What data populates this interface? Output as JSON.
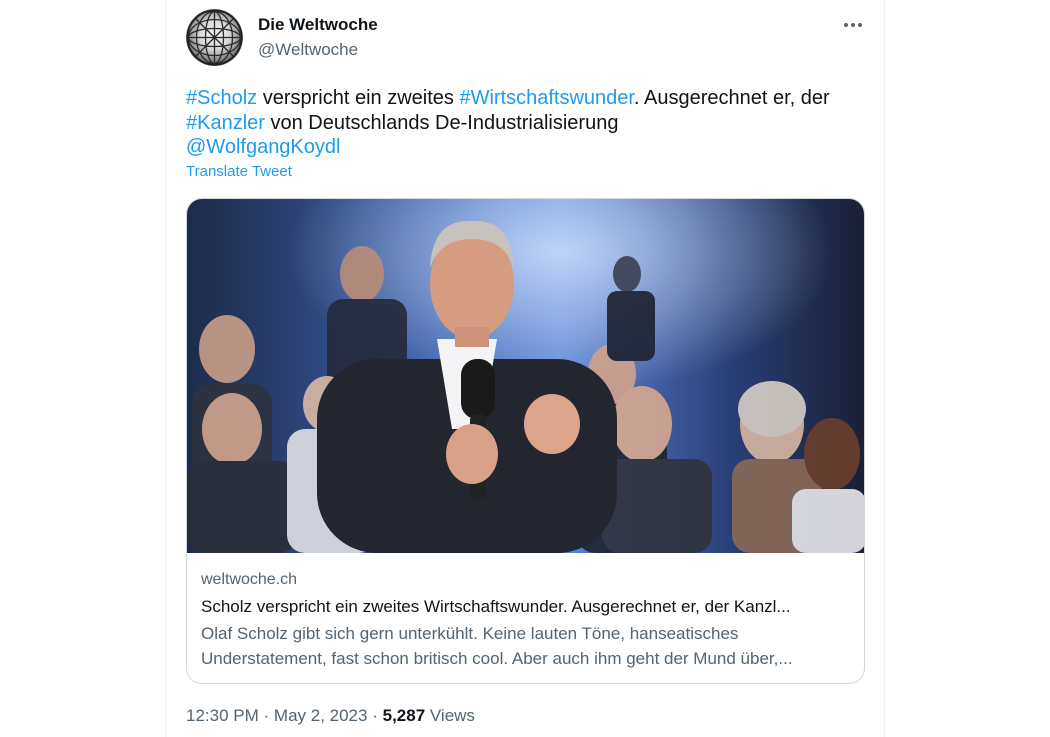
{
  "tweet": {
    "display_name": "Die Weltwoche",
    "handle": "@Weltwoche",
    "avatar_icon": "globe-wireframe-logo",
    "more_icon": "more-options-icon",
    "text": {
      "hashtag_scholz": "#Scholz",
      "t1": " verspricht ein zweites ",
      "hashtag_wirtschaftswunder": "#Wirtschaftswunder",
      "t2": ". Ausgerechnet er, der ",
      "hashtag_kanzler": "#Kanzler",
      "t3": " von Deutschlands De-Industrialisierung",
      "mention": "@WolfgangKoydl"
    },
    "translate_label": "Translate Tweet",
    "link_card": {
      "domain": "weltwoche.ch",
      "title": "Scholz verspricht ein zweites Wirtschaftswunder. Ausgerechnet er, der Kanzl...",
      "description": "Olaf Scholz gibt sich gern unterkühlt. Keine lauten Töne, hanseatisches Understatement, fast schon britisch cool. Aber auch ihm geht der Mund über,..."
    },
    "meta": {
      "time": "12:30 PM",
      "separator": "·",
      "date": "May 2, 2023",
      "views_count": "5,287",
      "views_label": "Views"
    }
  },
  "colors": {
    "link": "#1d9bf0",
    "text_primary": "#0f1419",
    "text_secondary": "#536471",
    "border": "#cfd9de"
  }
}
